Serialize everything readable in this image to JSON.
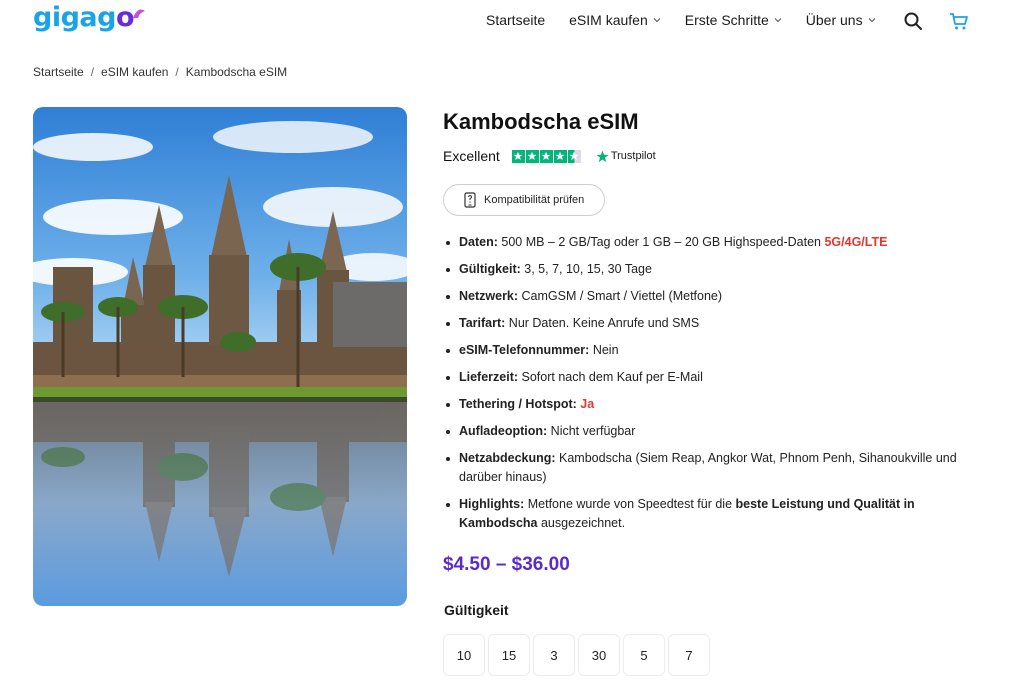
{
  "brand": {
    "logo_text": "gigago",
    "logo_main": "gigag",
    "logo_o": "o",
    "color_primary": "#1aa3e8",
    "color_accent": "#6a2bd9"
  },
  "nav": {
    "items": [
      {
        "label": "Startseite",
        "has_dropdown": false
      },
      {
        "label": "eSIM kaufen",
        "has_dropdown": true
      },
      {
        "label": "Erste Schritte",
        "has_dropdown": true
      },
      {
        "label": "Über uns",
        "has_dropdown": true
      }
    ],
    "search_icon": "search-icon",
    "cart_icon": "cart-icon"
  },
  "breadcrumb": {
    "items": [
      "Startseite",
      "eSIM kaufen",
      "Kambodscha eSIM"
    ],
    "separator": "/"
  },
  "product": {
    "image_alt": "Angkor Wat",
    "title": "Kambodscha eSIM",
    "rating_label": "Excellent",
    "rating_stars": 4.5,
    "trustpilot_label": "Trustpilot",
    "compat_button": "Kompatibilität prüfen",
    "features": [
      {
        "label": "Daten:",
        "text": " 500 MB – 2 GB/Tag oder 1 GB – 20 GB Highspeed-Daten ",
        "highlight": "5G/4G/LTE"
      },
      {
        "label": "Gültigkeit:",
        "text": " 3, 5, 7, 10, 15, 30 Tage"
      },
      {
        "label": "Netzwerk:",
        "text": " CamGSM / Smart / Viettel (Metfone)"
      },
      {
        "label": "Tarifart:",
        "text": " Nur Daten. Keine Anrufe und SMS"
      },
      {
        "label": "eSIM-Telefonnummer:",
        "text": " Nein"
      },
      {
        "label": "Lieferzeit:",
        "text": " Sofort nach dem Kauf per E-Mail"
      },
      {
        "label": "Tethering / Hotspot:",
        "text": " ",
        "highlight": "Ja"
      },
      {
        "label": "Aufladeoption:",
        "text": " Nicht verfügbar"
      },
      {
        "label": "Netzabdeckung:",
        "text": " Kambodscha (Siem Reap, Angkor Wat, Phnom Penh, Sihanoukville und darüber hinaus)"
      },
      {
        "label": "Highlights:",
        "text": " Metfone wurde von Speedtest für die ",
        "bold": "beste Leistung und Qualität in Kambodscha",
        "text2": " ausgezeichnet."
      }
    ],
    "price": "$4.50 – $36.00",
    "price_color": "#5b2bc9",
    "highlight_color": "#e0382f",
    "validity_label": "Gültigkeit",
    "validity_options": [
      "10",
      "15",
      "3",
      "30",
      "5",
      "7"
    ]
  }
}
